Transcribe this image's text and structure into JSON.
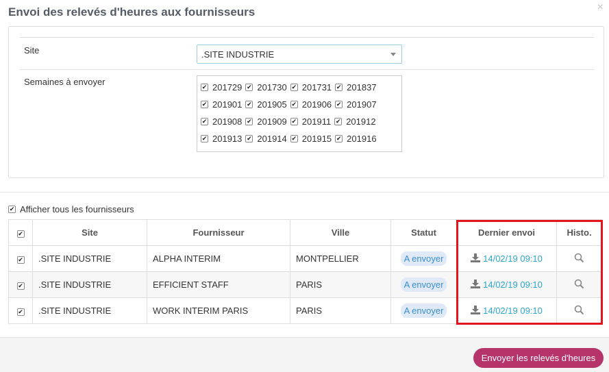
{
  "modal": {
    "title": "Envoi des relevés d'heures aux fournisseurs",
    "close_icon": "close-icon"
  },
  "filters": {
    "site_label": "Site",
    "site_value": ".SITE INDUSTRIE",
    "weeks_label": "Semaines à envoyer",
    "weeks": [
      [
        "201729",
        "201730",
        "201731",
        "201837"
      ],
      [
        "201901",
        "201905",
        "201906",
        "201907"
      ],
      [
        "201908",
        "201909",
        "201911",
        "201912"
      ],
      [
        "201913",
        "201914",
        "201915",
        "201916"
      ]
    ],
    "weeks_checked": true
  },
  "show_all": {
    "label": "Afficher tous les fournisseurs",
    "checked": true
  },
  "table": {
    "headers": {
      "site": "Site",
      "supplier": "Fournisseur",
      "city": "Ville",
      "status": "Statut",
      "last_sent": "Dernier envoi",
      "history": "Histo."
    },
    "rows": [
      {
        "site": ".SITE INDUSTRIE",
        "supplier": "ALPHA INTERIM",
        "city": "MONTPELLIER",
        "status": "A envoyer",
        "last_sent": "14/02/19 09:10"
      },
      {
        "site": ".SITE INDUSTRIE",
        "supplier": "EFFICIENT STAFF",
        "city": "PARIS",
        "status": "A envoyer",
        "last_sent": "14/02/19 09:10"
      },
      {
        "site": ".SITE INDUSTRIE",
        "supplier": "WORK INTERIM PARIS",
        "city": "PARIS",
        "status": "A envoyer",
        "last_sent": "14/02/19 09:10"
      }
    ]
  },
  "footer": {
    "send_button": "Envoyer les relevés d'heures"
  },
  "colors": {
    "accent_button": "#b6346a",
    "link": "#2aa6d1",
    "badge_bg": "#dfe9f7",
    "badge_text": "#3a8fd6",
    "highlight_box": "#e2141e"
  },
  "icons": {
    "download": "download-icon",
    "search": "search-icon",
    "dropdown": "chevron-down-icon"
  }
}
